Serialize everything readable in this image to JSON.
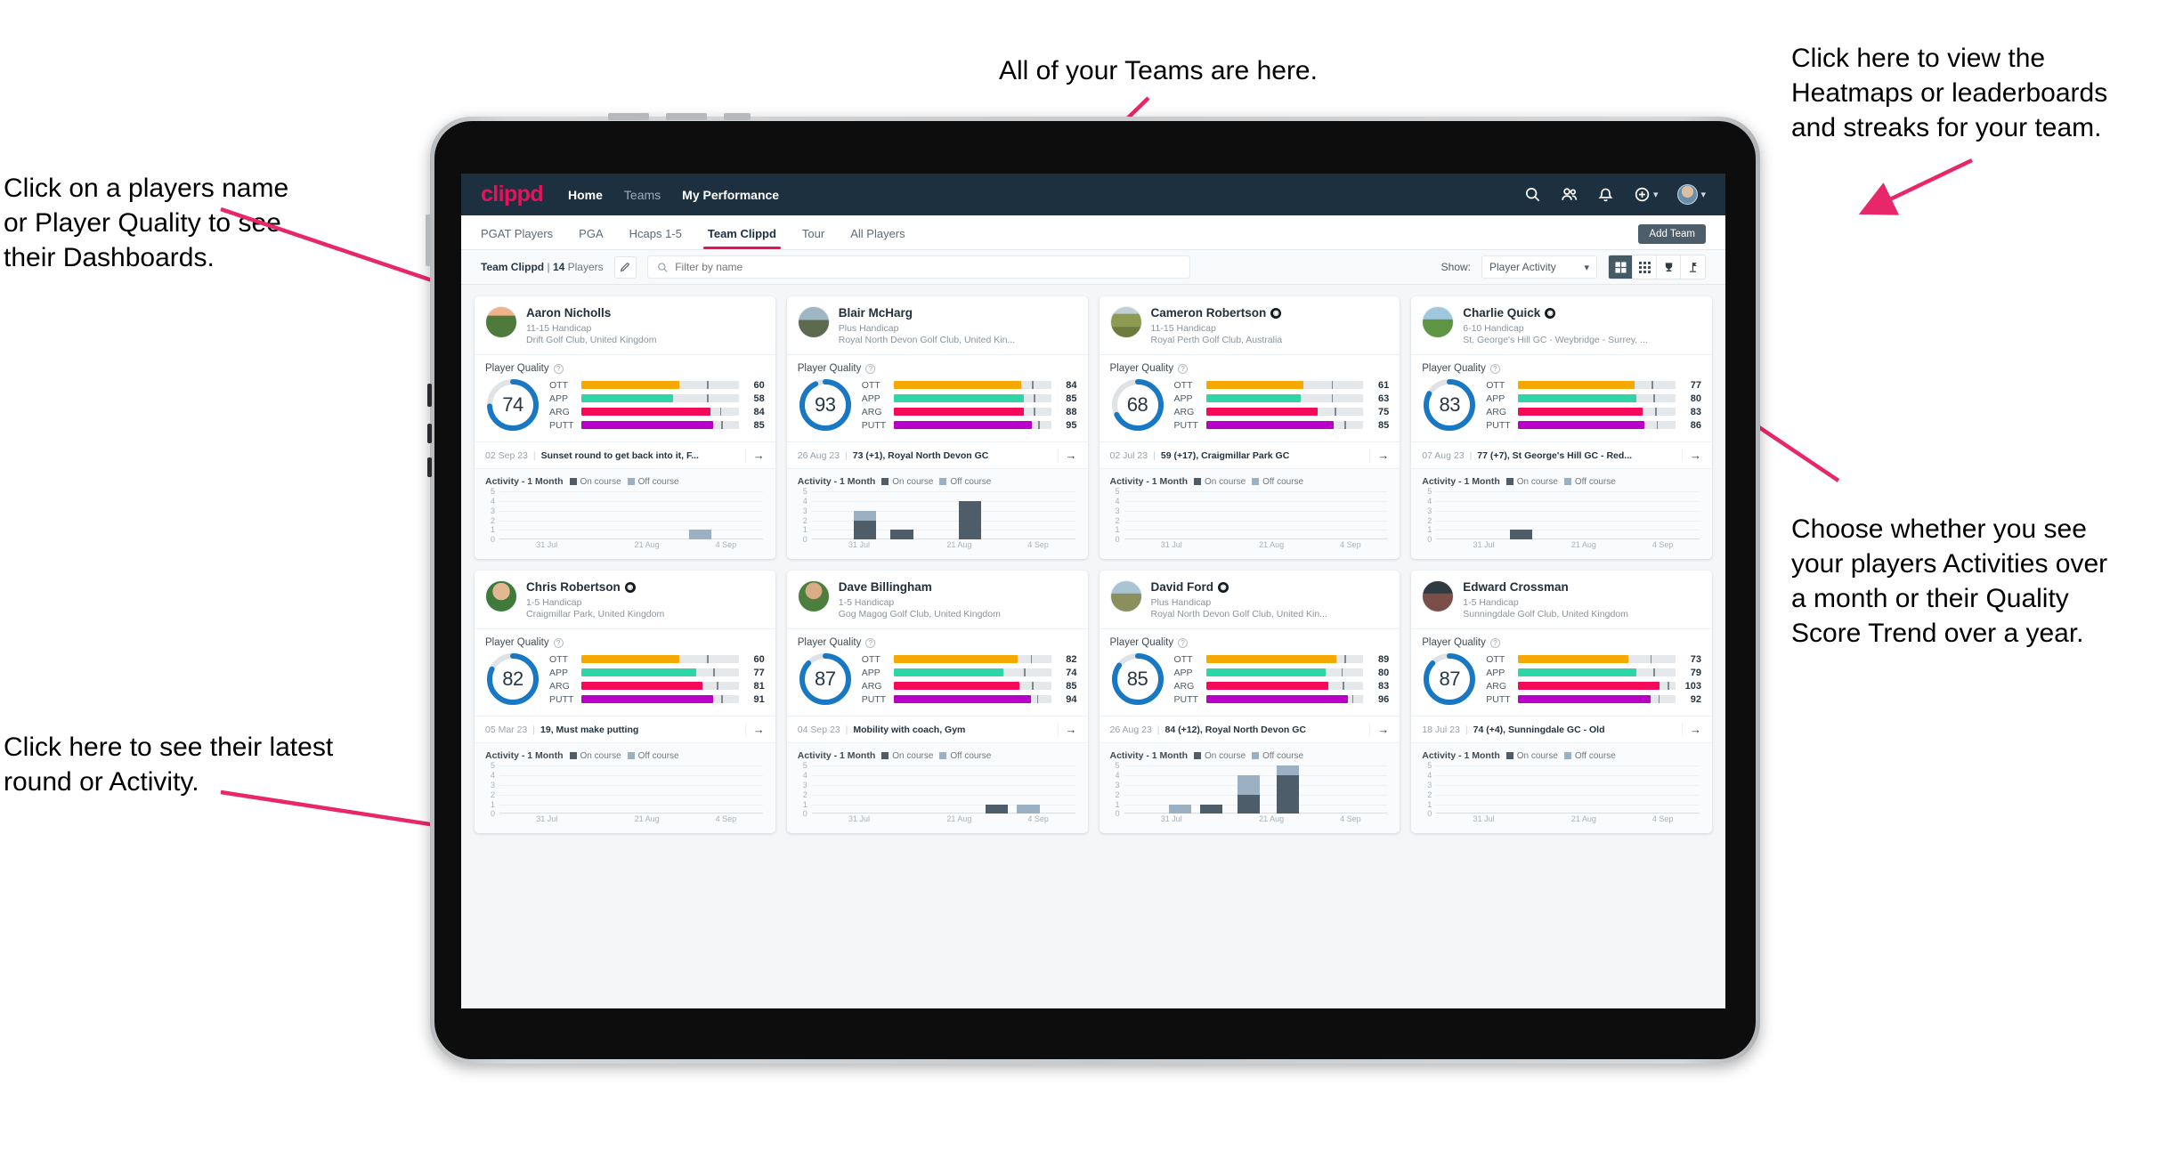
{
  "annotations": {
    "teams": "All of your Teams are here.",
    "heatmaps": "Click here to view the\nHeatmaps or leaderboards\nand streaks for your team.",
    "names": "Click on a players name\nor Player Quality to see\ntheir Dashboards.",
    "choose": "Choose whether you see\nyour players Activities over\na month or their Quality\nScore Trend over a year.",
    "round": "Click here to see their latest\nround or Activity."
  },
  "appbar": {
    "logo": "clippd",
    "nav": [
      {
        "label": "Home",
        "active": true
      },
      {
        "label": "Teams",
        "active": false
      },
      {
        "label": "My Performance",
        "active": true
      }
    ],
    "icons": [
      "search-icon",
      "people-icon",
      "bell-icon",
      "plus-circle-icon",
      "avatar"
    ],
    "brand_color": "#e8115b",
    "bar_color": "#1c3040"
  },
  "tabs": [
    {
      "label": "PGAT Players",
      "active": false
    },
    {
      "label": "PGA",
      "active": false
    },
    {
      "label": "Hcaps 1-5",
      "active": false
    },
    {
      "label": "Team Clippd",
      "active": true
    },
    {
      "label": "Tour",
      "active": false
    },
    {
      "label": "All Players",
      "active": false
    }
  ],
  "add_team_label": "Add Team",
  "toolbar": {
    "team_name": "Team Clippd",
    "separator": "|",
    "player_count": "14",
    "players_word": "Players",
    "edit_icon": "pencil-icon",
    "search_placeholder": "Filter by name",
    "show_label": "Show:",
    "show_value": "Player Activity",
    "view_buttons": [
      "grid-large-icon",
      "grid-small-icon",
      "trophy-icon",
      "flag-icon"
    ],
    "active_view": 0
  },
  "chart_data": {
    "type": "bar",
    "title": "Activity - 1 Month",
    "legend": [
      "On course",
      "Off course"
    ],
    "ylim": [
      0,
      5
    ],
    "yticks": [
      0,
      1,
      2,
      3,
      4,
      5
    ],
    "xlabels": [
      "31 Jul",
      "21 Aug",
      "4 Sep"
    ],
    "colors": {
      "on_course": "#4e5d6a",
      "off_course": "#9bb0c2"
    }
  },
  "cards": [
    {
      "name": "Aaron Nicholls",
      "coach": false,
      "avatar": "a0",
      "handicap": "11-15 Handicap",
      "club": "Drift Golf Club, United Kingdom",
      "quality_label": "Player Quality",
      "score": 74,
      "metrics": [
        {
          "label": "OTT",
          "value": 60,
          "fill": 0.62,
          "mark": 0.8,
          "color": "#f5a800"
        },
        {
          "label": "APP",
          "value": 58,
          "fill": 0.58,
          "mark": 0.8,
          "color": "#2fd4a7"
        },
        {
          "label": "ARG",
          "value": 84,
          "fill": 0.82,
          "mark": 0.88,
          "color": "#f50a5a"
        },
        {
          "label": "PUTT",
          "value": 85,
          "fill": 0.84,
          "mark": 0.89,
          "color": "#b800c8"
        }
      ],
      "latest_date": "02 Sep 23",
      "latest_text": "Sunset round to get back into it, F...",
      "activity": [
        {
          "x": 0.72,
          "on": 0,
          "off": 1
        }
      ]
    },
    {
      "name": "Blair McHarg",
      "coach": false,
      "avatar": "a1",
      "handicap": "Plus Handicap",
      "club": "Royal North Devon Golf Club, United Kin...",
      "quality_label": "Player Quality",
      "score": 93,
      "metrics": [
        {
          "label": "OTT",
          "value": 84,
          "fill": 0.81,
          "mark": 0.88,
          "color": "#f5a800"
        },
        {
          "label": "APP",
          "value": 85,
          "fill": 0.83,
          "mark": 0.89,
          "color": "#2fd4a7"
        },
        {
          "label": "ARG",
          "value": 88,
          "fill": 0.83,
          "mark": 0.89,
          "color": "#f50a5a"
        },
        {
          "label": "PUTT",
          "value": 95,
          "fill": 0.88,
          "mark": 0.92,
          "color": "#b800c8"
        }
      ],
      "latest_date": "26 Aug 23",
      "latest_text": "73 (+1), Royal North Devon GC",
      "activity": [
        {
          "x": 0.16,
          "on": 2,
          "off": 1
        },
        {
          "x": 0.3,
          "on": 1,
          "off": 0
        },
        {
          "x": 0.56,
          "on": 4,
          "off": 0
        }
      ]
    },
    {
      "name": "Cameron Robertson",
      "coach": true,
      "avatar": "a2",
      "handicap": "11-15 Handicap",
      "club": "Royal Perth Golf Club, Australia",
      "quality_label": "Player Quality",
      "score": 68,
      "metrics": [
        {
          "label": "OTT",
          "value": 61,
          "fill": 0.62,
          "mark": 0.8,
          "color": "#f5a800"
        },
        {
          "label": "APP",
          "value": 63,
          "fill": 0.6,
          "mark": 0.8,
          "color": "#2fd4a7"
        },
        {
          "label": "ARG",
          "value": 75,
          "fill": 0.71,
          "mark": 0.82,
          "color": "#f50a5a"
        },
        {
          "label": "PUTT",
          "value": 85,
          "fill": 0.81,
          "mark": 0.88,
          "color": "#b800c8"
        }
      ],
      "latest_date": "02 Jul 23",
      "latest_text": "59 (+17), Craigmillar Park GC",
      "activity": []
    },
    {
      "name": "Charlie Quick",
      "coach": true,
      "avatar": "a3",
      "handicap": "6-10 Handicap",
      "club": "St. George's Hill GC - Weybridge - Surrey, ...",
      "quality_label": "Player Quality",
      "score": 83,
      "metrics": [
        {
          "label": "OTT",
          "value": 77,
          "fill": 0.74,
          "mark": 0.85,
          "color": "#f5a800"
        },
        {
          "label": "APP",
          "value": 80,
          "fill": 0.75,
          "mark": 0.86,
          "color": "#2fd4a7"
        },
        {
          "label": "ARG",
          "value": 83,
          "fill": 0.79,
          "mark": 0.87,
          "color": "#f50a5a"
        },
        {
          "label": "PUTT",
          "value": 86,
          "fill": 0.8,
          "mark": 0.88,
          "color": "#b800c8"
        }
      ],
      "latest_date": "07 Aug 23",
      "latest_text": "77 (+7), St George's Hill GC - Red...",
      "activity": [
        {
          "x": 0.28,
          "on": 1,
          "off": 0
        }
      ]
    },
    {
      "name": "Chris Robertson",
      "coach": true,
      "avatar": "a4",
      "handicap": "1-5 Handicap",
      "club": "Craigmillar Park, United Kingdom",
      "quality_label": "Player Quality",
      "score": 82,
      "metrics": [
        {
          "label": "OTT",
          "value": 60,
          "fill": 0.62,
          "mark": 0.8,
          "color": "#f5a800"
        },
        {
          "label": "APP",
          "value": 77,
          "fill": 0.73,
          "mark": 0.84,
          "color": "#2fd4a7"
        },
        {
          "label": "ARG",
          "value": 81,
          "fill": 0.77,
          "mark": 0.86,
          "color": "#f50a5a"
        },
        {
          "label": "PUTT",
          "value": 91,
          "fill": 0.84,
          "mark": 0.89,
          "color": "#b800c8"
        }
      ],
      "latest_date": "05 Mar 23",
      "latest_text": "19, Must make putting",
      "activity": []
    },
    {
      "name": "Dave Billingham",
      "coach": false,
      "avatar": "a5",
      "handicap": "1-5 Handicap",
      "club": "Gog Magog Golf Club, United Kingdom",
      "quality_label": "Player Quality",
      "score": 87,
      "metrics": [
        {
          "label": "OTT",
          "value": 82,
          "fill": 0.79,
          "mark": 0.87,
          "color": "#f5a800"
        },
        {
          "label": "APP",
          "value": 74,
          "fill": 0.7,
          "mark": 0.83,
          "color": "#2fd4a7"
        },
        {
          "label": "ARG",
          "value": 85,
          "fill": 0.8,
          "mark": 0.88,
          "color": "#f50a5a"
        },
        {
          "label": "PUTT",
          "value": 94,
          "fill": 0.87,
          "mark": 0.91,
          "color": "#b800c8"
        }
      ],
      "latest_date": "04 Sep 23",
      "latest_text": "Mobility with coach, Gym",
      "activity": [
        {
          "x": 0.66,
          "on": 1,
          "off": 0
        },
        {
          "x": 0.78,
          "on": 0,
          "off": 1
        }
      ]
    },
    {
      "name": "David Ford",
      "coach": true,
      "avatar": "a6",
      "handicap": "Plus Handicap",
      "club": "Royal North Devon Golf Club, United Kin...",
      "quality_label": "Player Quality",
      "score": 85,
      "metrics": [
        {
          "label": "OTT",
          "value": 89,
          "fill": 0.83,
          "mark": 0.88,
          "color": "#f5a800"
        },
        {
          "label": "APP",
          "value": 80,
          "fill": 0.76,
          "mark": 0.86,
          "color": "#2fd4a7"
        },
        {
          "label": "ARG",
          "value": 83,
          "fill": 0.78,
          "mark": 0.87,
          "color": "#f50a5a"
        },
        {
          "label": "PUTT",
          "value": 96,
          "fill": 0.9,
          "mark": 0.93,
          "color": "#b800c8"
        }
      ],
      "latest_date": "26 Aug 23",
      "latest_text": "84 (+12), Royal North Devon GC",
      "activity": [
        {
          "x": 0.17,
          "on": 0,
          "off": 1
        },
        {
          "x": 0.29,
          "on": 1,
          "off": 0
        },
        {
          "x": 0.43,
          "on": 2,
          "off": 2
        },
        {
          "x": 0.58,
          "on": 4,
          "off": 1
        }
      ]
    },
    {
      "name": "Edward Crossman",
      "coach": false,
      "avatar": "a7",
      "handicap": "1-5 Handicap",
      "club": "Sunningdale Golf Club, United Kingdom",
      "quality_label": "Player Quality",
      "score": 87,
      "metrics": [
        {
          "label": "OTT",
          "value": 73,
          "fill": 0.7,
          "mark": 0.84,
          "color": "#f5a800"
        },
        {
          "label": "APP",
          "value": 79,
          "fill": 0.75,
          "mark": 0.86,
          "color": "#2fd4a7"
        },
        {
          "label": "ARG",
          "value": 103,
          "fill": 0.9,
          "mark": 0.95,
          "color": "#f50a5a"
        },
        {
          "label": "PUTT",
          "value": 92,
          "fill": 0.84,
          "mark": 0.89,
          "color": "#b800c8"
        }
      ],
      "latest_date": "18 Jul 23",
      "latest_text": "74 (+4), Sunningdale GC - Old",
      "activity": []
    }
  ]
}
